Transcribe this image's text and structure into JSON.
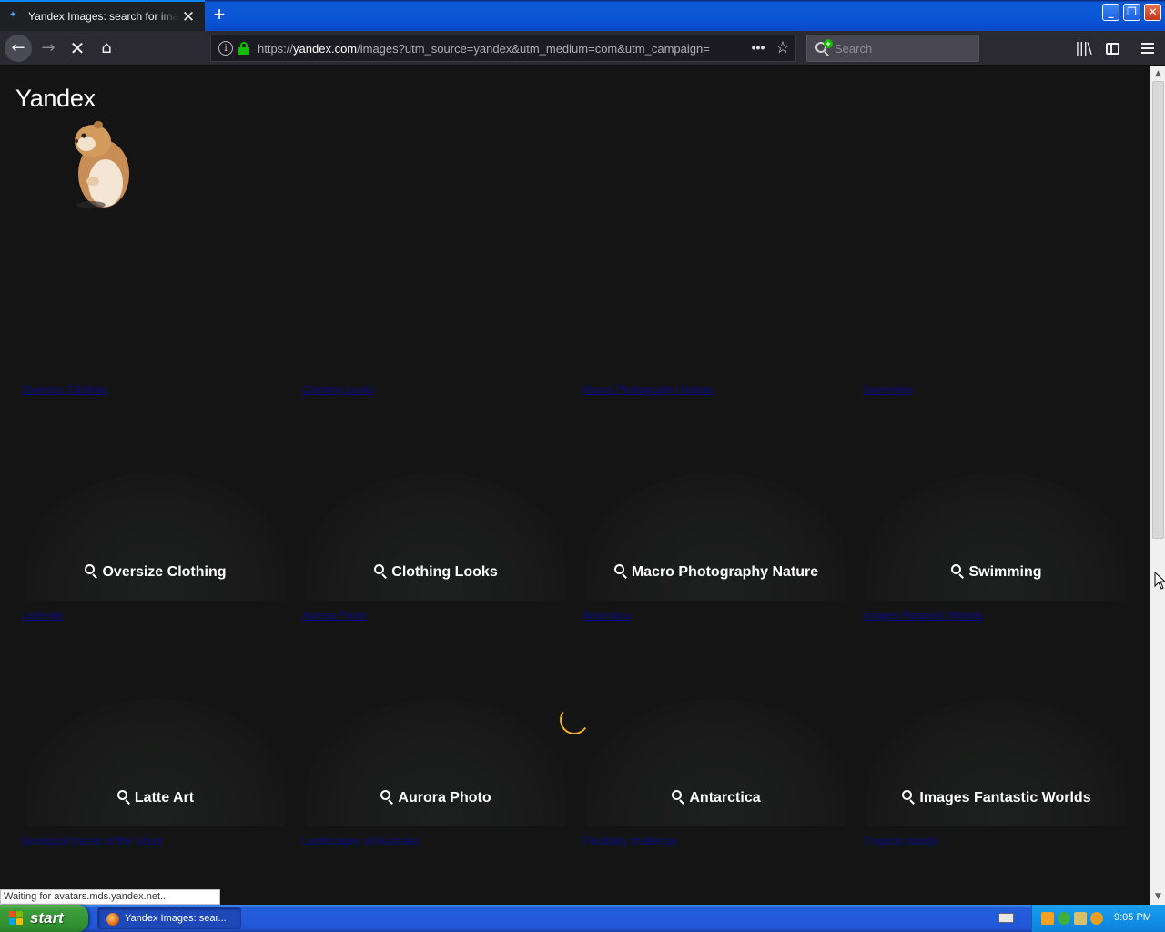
{
  "browser": {
    "tab_title": "Yandex Images: search for images",
    "new_tab_symbol": "+",
    "url_scheme": "https://",
    "url_host": "yandex.com",
    "url_path": "/images?utm_source=yandex&utm_medium=com&utm_campaign=",
    "search_placeholder": "Search",
    "status_text": "Waiting for avatars.mds.yandex.net..."
  },
  "page": {
    "logo": "Yandex",
    "rows": [
      {
        "links": [
          "Oversize Clothing",
          "Clothing Looks",
          "Macro Photography Nature",
          "Swimming"
        ],
        "cards": []
      },
      {
        "links": [
          "Latte Art",
          "Aurora Photo",
          "Antarctica",
          "Images Fantastic Worlds"
        ],
        "cards": [
          "Oversize Clothing",
          "Clothing Looks",
          "Macro Photography Nature",
          "Swimming"
        ]
      },
      {
        "links": [
          "Biological traces of the future",
          "Landscapes of Australia",
          "Flexibility challenge",
          "Tropical islands"
        ],
        "cards": [
          "Latte Art",
          "Aurora Photo",
          "Antarctica",
          "Images Fantastic Worlds"
        ]
      }
    ]
  },
  "taskbar": {
    "start_label": "start",
    "task_label": "Yandex Images: sear...",
    "clock": "9:05 PM"
  },
  "colors": {
    "page_bg": "#141414",
    "link": "#0000ee",
    "spinner": "#f0b020",
    "xp_start": "#3c9c3b",
    "xp_taskbar": "#245edb"
  },
  "icons": [
    "back-arrow-icon",
    "forward-arrow-icon",
    "stop-icon",
    "home-icon",
    "info-icon",
    "lock-icon",
    "more-actions-icon",
    "bookmark-star-icon",
    "search-icon",
    "library-icon",
    "sidebar-icon",
    "menu-icon",
    "loading-spinner-icon"
  ]
}
